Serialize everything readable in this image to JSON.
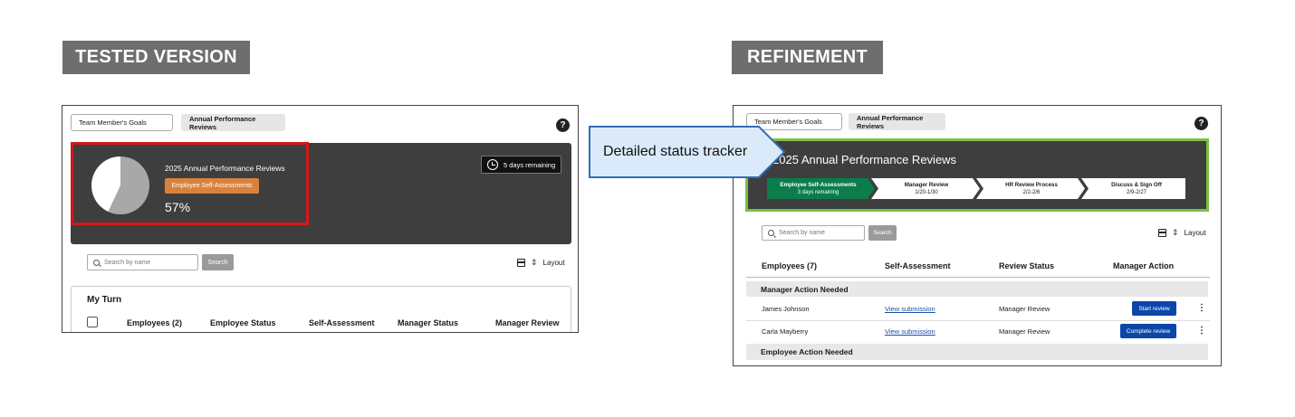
{
  "labels": {
    "tested": "TESTED VERSION",
    "refinement": "REFINEMENT"
  },
  "callout": "Detailed status tracker",
  "colors": {
    "highlight_tested": "#d2191b",
    "highlight_refinement": "#7cc043",
    "dark_panel": "#3e3e3e",
    "badge": "#d9823b",
    "active_step": "#0a7d4a",
    "primary_button": "#0b46a8"
  },
  "tested": {
    "tabs": [
      "Team Member's Goals",
      "Annual Performance Reviews"
    ],
    "help_icon": "?",
    "review_title": "2025 Annual Performance Reviews",
    "stage_badge": "Employee Self-Assessments",
    "progress_percent": "57%",
    "progress_value": 0.57,
    "days_remaining": "5 days remaining",
    "search_placeholder": "Search by name",
    "search_button": "Search",
    "layout_label": "Layout",
    "section_title": "My Turn",
    "columns": [
      "Employees (2)",
      "Employee Status",
      "Self-Assessment",
      "Manager Status",
      "Manager Review"
    ]
  },
  "refinement": {
    "tabs": [
      "Team Member's Goals",
      "Annual Performance Reviews"
    ],
    "help_icon": "?",
    "review_title": "2025 Annual Performance Reviews",
    "steps": [
      {
        "title": "Employee Self-Assessments",
        "sub": "3 days remaining",
        "active": true
      },
      {
        "title": "Manager Review",
        "sub": "1/20-1/30",
        "active": false
      },
      {
        "title": "HR Review Process",
        "sub": "2/2-2/6",
        "active": false
      },
      {
        "title": "Discuss & Sign Off",
        "sub": "2/9-2/27",
        "active": false
      }
    ],
    "search_placeholder": "Search by name",
    "search_button": "Search",
    "layout_label": "Layout",
    "columns": [
      "Employees (7)",
      "Self-Assessment",
      "Review Status",
      "Manager Action"
    ],
    "groups": {
      "manager_needed": "Manager Action Needed",
      "employee_needed": "Employee Action Needed"
    },
    "rows": [
      {
        "name": "James Johnson",
        "self_assessment": "View submission",
        "status": "Manager Review",
        "action": "Start review"
      },
      {
        "name": "Carla Mayberry",
        "self_assessment": "View submission",
        "status": "Manager Review",
        "action": "Complete review"
      }
    ]
  }
}
